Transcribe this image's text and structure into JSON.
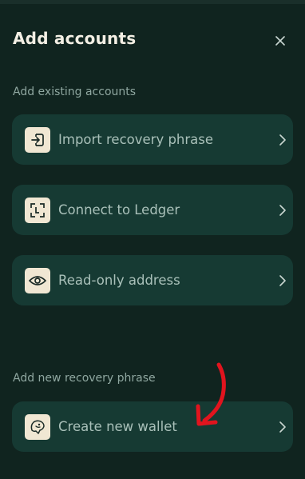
{
  "header": {
    "title": "Add accounts",
    "close_icon": "close-icon"
  },
  "sections": {
    "existing_label": "Add existing accounts",
    "new_label": "Add new recovery phrase"
  },
  "options": [
    {
      "label": "Import recovery phrase",
      "icon": "import-icon"
    },
    {
      "label": "Connect to Ledger",
      "icon": "ledger-icon"
    },
    {
      "label": "Read-only address",
      "icon": "eye-icon"
    },
    {
      "label": "Create new wallet",
      "icon": "wallet-creature-icon"
    }
  ],
  "colors": {
    "background": "#10241f",
    "card": "#163a33",
    "icon_tile": "#f0e7d3",
    "text_primary": "#f3efe4",
    "text_secondary": "#a9c0b9",
    "annotation": "#e1141e"
  }
}
